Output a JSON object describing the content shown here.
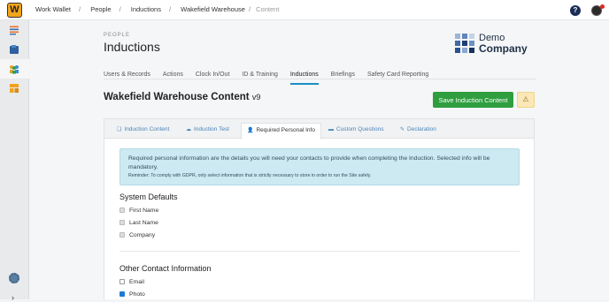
{
  "app": {
    "logo_letter": "W"
  },
  "breadcrumb": [
    "Work Wallet",
    "People",
    "Inductions",
    "Wakefield Warehouse",
    "Content"
  ],
  "header": {
    "help_label": "?"
  },
  "page": {
    "eyebrow": "PEOPLE",
    "title": "Inductions",
    "brand_line1": "Demo",
    "brand_line2": "Company"
  },
  "tabs": [
    "Users & Records",
    "Actions",
    "Clock In/Out",
    "ID & Training",
    "Inductions",
    "Briefings",
    "Safety Card Reporting"
  ],
  "active_tab": "Inductions",
  "content": {
    "title": "Wakefield Warehouse Content",
    "version": "v9",
    "save_label": "Save Induction Content",
    "warn_icon": "⚠"
  },
  "subtabs": [
    {
      "label": "Induction Content",
      "icon": "❏"
    },
    {
      "label": "Induction Test",
      "icon": "☁"
    },
    {
      "label": "Required Personal Info",
      "icon": "👤"
    },
    {
      "label": "Custom Questions",
      "icon": "▬"
    },
    {
      "label": "Declaration",
      "icon": "✎"
    }
  ],
  "active_subtab": "Required Personal Info",
  "info": {
    "text": "Required personal information are the details you will need your contacts to provide when completing the Induction. Selected info will be mandatory.",
    "reminder": "Reminder: To comply with GDPR, only select information that is strictly necessary to store in order to run the Site safely."
  },
  "system_defaults": {
    "heading": "System Defaults",
    "items": [
      {
        "label": "First Name",
        "checked": true,
        "disabled": true
      },
      {
        "label": "Last Name",
        "checked": true,
        "disabled": true
      },
      {
        "label": "Company",
        "checked": true,
        "disabled": true
      }
    ]
  },
  "other_contact": {
    "heading": "Other Contact Information",
    "items": [
      {
        "label": "Email",
        "checked": false
      },
      {
        "label": "Photo",
        "checked": true
      }
    ]
  },
  "colors": {
    "accent": "#1a8fc7",
    "save": "#2e9e3e",
    "info_bg": "#cde9f2",
    "brand": "#1f3047"
  }
}
